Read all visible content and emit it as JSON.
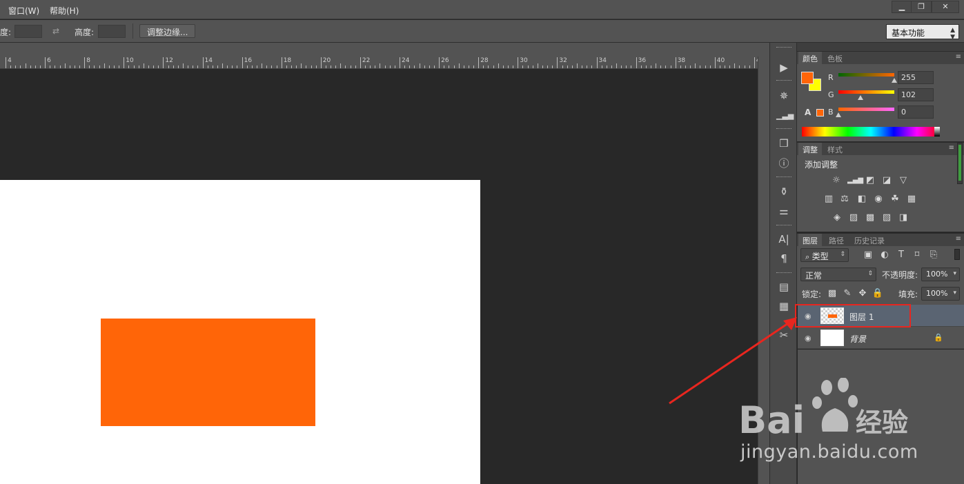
{
  "menubar": {
    "items": [
      "窗口(W)",
      "帮助(H)"
    ],
    "window_controls": [
      "minimize-icon",
      "restore-icon",
      "close-icon"
    ]
  },
  "options_bar": {
    "width_label": "度:",
    "height_label": "高度:",
    "refine_edge_button": "调整边缘...",
    "workspace": "基本功能"
  },
  "ruler": {
    "labels": [
      "4",
      "6",
      "8",
      "10",
      "12",
      "14",
      "16",
      "18",
      "20",
      "22",
      "24",
      "26",
      "28",
      "30",
      "32",
      "34",
      "36",
      "38",
      "40",
      "4"
    ]
  },
  "color_panel": {
    "tabs": [
      "颜色",
      "色板"
    ],
    "active_tab": "颜色",
    "foreground": "#ff6508",
    "background": "#ffff00",
    "channels": [
      {
        "name": "R",
        "value": "255",
        "level": 1.0
      },
      {
        "name": "G",
        "value": "102",
        "level": 0.4
      },
      {
        "name": "B",
        "value": "0",
        "level": 0.0
      }
    ]
  },
  "adjustments_panel": {
    "tabs": [
      "调整",
      "样式"
    ],
    "active_tab": "调整",
    "title": "添加调整"
  },
  "layers_panel": {
    "tabs": [
      "图层",
      "路径",
      "历史记录"
    ],
    "active_tab": "图层",
    "filter_kind": "类型",
    "blend_mode": "正常",
    "opacity_label": "不透明度:",
    "opacity_value": "100%",
    "lock_label": "锁定:",
    "fill_label": "填充:",
    "fill_value": "100%",
    "layers": [
      {
        "name": "图层 1",
        "selected": true,
        "thumbnail": "checker-orange"
      },
      {
        "name": "背景",
        "selected": false,
        "thumbnail": "white",
        "locked": true
      }
    ]
  },
  "canvas": {
    "document_color": "#ffffff",
    "shape_color": "#ff6508"
  },
  "annotation": {
    "highlight_color": "#e8261f"
  },
  "watermark": {
    "brand": "Bai",
    "brand_suffix": "经验",
    "url": "jingyan.baidu.com"
  }
}
